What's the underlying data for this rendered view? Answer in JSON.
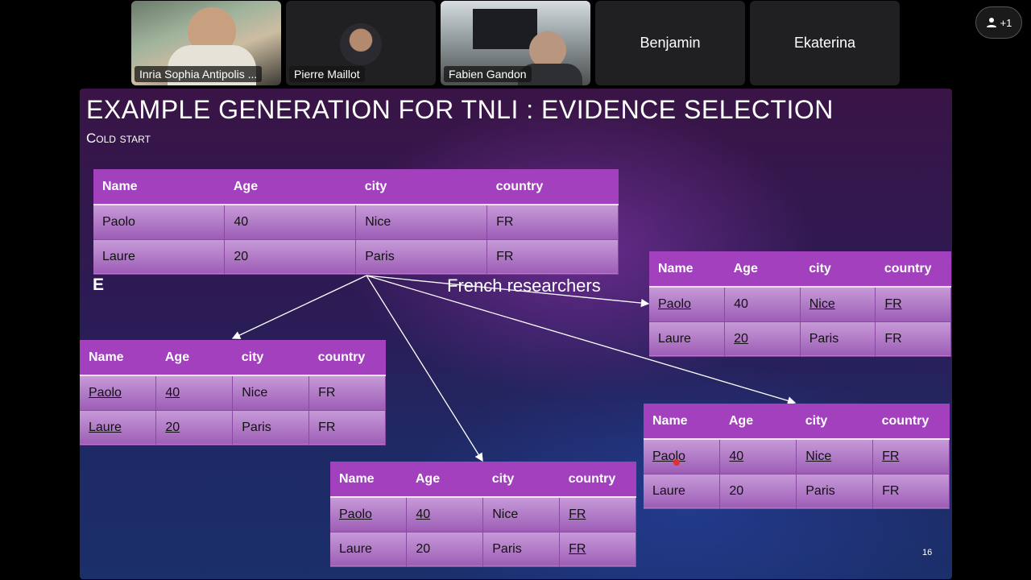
{
  "participants": [
    {
      "name": "Inria Sophia Antipolis ...",
      "type": "video"
    },
    {
      "name": "Pierre Maillot",
      "type": "avatar"
    },
    {
      "name": "Fabien Gandon",
      "type": "video"
    },
    {
      "name": "Benjamin",
      "type": "name-only"
    },
    {
      "name": "Ekaterina",
      "type": "name-only"
    }
  ],
  "more_button": {
    "label": "+1",
    "icon": "person-icon"
  },
  "slide": {
    "title": "EXAMPLE GENERATION FOR TNLI : EVIDENCE SELECTION",
    "subtitle": "Cold start",
    "e_label": "E",
    "hypothesis_label": "French researchers",
    "page_number": "16"
  },
  "tables": [
    {
      "id": "source",
      "headers": [
        "Name",
        "Age",
        "city",
        "country"
      ],
      "rows": [
        [
          "Paolo",
          "40",
          "Nice",
          "FR"
        ],
        [
          "Laure",
          "20",
          "Paris",
          "FR"
        ]
      ],
      "underlined": [
        [
          false,
          false,
          false,
          false
        ],
        [
          false,
          false,
          false,
          false
        ]
      ]
    },
    {
      "id": "evidence-right-top",
      "headers": [
        "Name",
        "Age",
        "city",
        "country"
      ],
      "rows": [
        [
          "Paolo",
          "40",
          "Nice",
          "FR"
        ],
        [
          "Laure",
          "20",
          "Paris",
          "FR"
        ]
      ],
      "underlined": [
        [
          true,
          false,
          true,
          true
        ],
        [
          false,
          true,
          false,
          false
        ]
      ]
    },
    {
      "id": "evidence-left",
      "headers": [
        "Name",
        "Age",
        "city",
        "country"
      ],
      "rows": [
        [
          "Paolo",
          "40",
          "Nice",
          "FR"
        ],
        [
          "Laure",
          "20",
          "Paris",
          "FR"
        ]
      ],
      "underlined": [
        [
          true,
          true,
          false,
          false
        ],
        [
          true,
          true,
          false,
          false
        ]
      ]
    },
    {
      "id": "evidence-bottom",
      "headers": [
        "Name",
        "Age",
        "city",
        "country"
      ],
      "rows": [
        [
          "Paolo",
          "40",
          "Nice",
          "FR"
        ],
        [
          "Laure",
          "20",
          "Paris",
          "FR"
        ]
      ],
      "underlined": [
        [
          true,
          true,
          false,
          true
        ],
        [
          false,
          false,
          false,
          true
        ]
      ]
    },
    {
      "id": "evidence-right-bottom",
      "headers": [
        "Name",
        "Age",
        "city",
        "country"
      ],
      "rows": [
        [
          "Paolo",
          "40",
          "Nice",
          "FR"
        ],
        [
          "Laure",
          "20",
          "Paris",
          "FR"
        ]
      ],
      "underlined": [
        [
          true,
          true,
          true,
          true
        ],
        [
          false,
          false,
          false,
          false
        ]
      ]
    }
  ]
}
